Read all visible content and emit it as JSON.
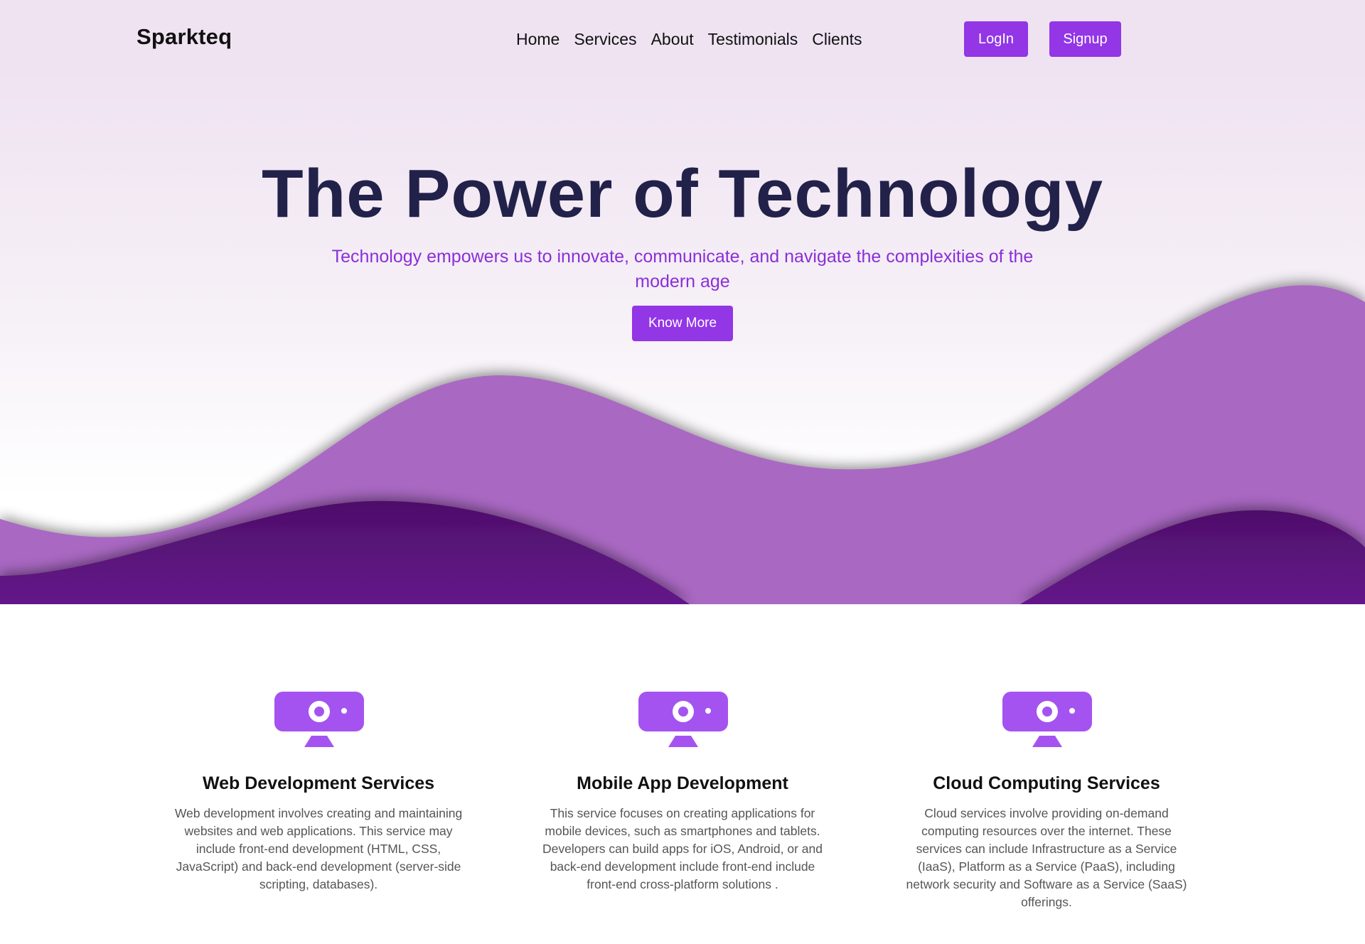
{
  "nav": {
    "brand": "Sparkteq",
    "links": [
      "Home",
      "Services",
      "About",
      "Testimonials",
      "Clients"
    ],
    "login_label": "LogIn",
    "signup_label": "Signup"
  },
  "hero": {
    "title": "The Power of Technology",
    "subtitle": "Technology empowers us to innovate, communicate, and navigate the complexities of the modern age",
    "cta_label": "Know More"
  },
  "services": [
    {
      "icon": "webcam-icon",
      "title": "Web Development Services",
      "description": "Web development involves creating and maintaining websites and web applications. This service may include front-end development (HTML, CSS, JavaScript) and back-end development (server-side scripting, databases)."
    },
    {
      "icon": "webcam-icon",
      "title": "Mobile App Development",
      "description": "This service focuses on creating applications for mobile devices, such as smartphones and tablets. Developers can build apps for iOS, Android, or and back-end development include front-end include front-end cross-platform solutions ."
    },
    {
      "icon": "webcam-icon",
      "title": "Cloud Computing Services",
      "description": "Cloud services involve providing on-demand computing resources over the internet. These services can include Infrastructure as a Service (IaaS), Platform as a Service (PaaS), including network security and Software as a Service (SaaS) offerings."
    }
  ],
  "colors": {
    "accent": "#9236e6",
    "title": "#22214a",
    "subtitle": "#8a2fd8",
    "wave_light": "#a967c2",
    "wave_dark": "#5a1577",
    "icon": "#a553f0",
    "nav_bg": "#efe3f2"
  }
}
